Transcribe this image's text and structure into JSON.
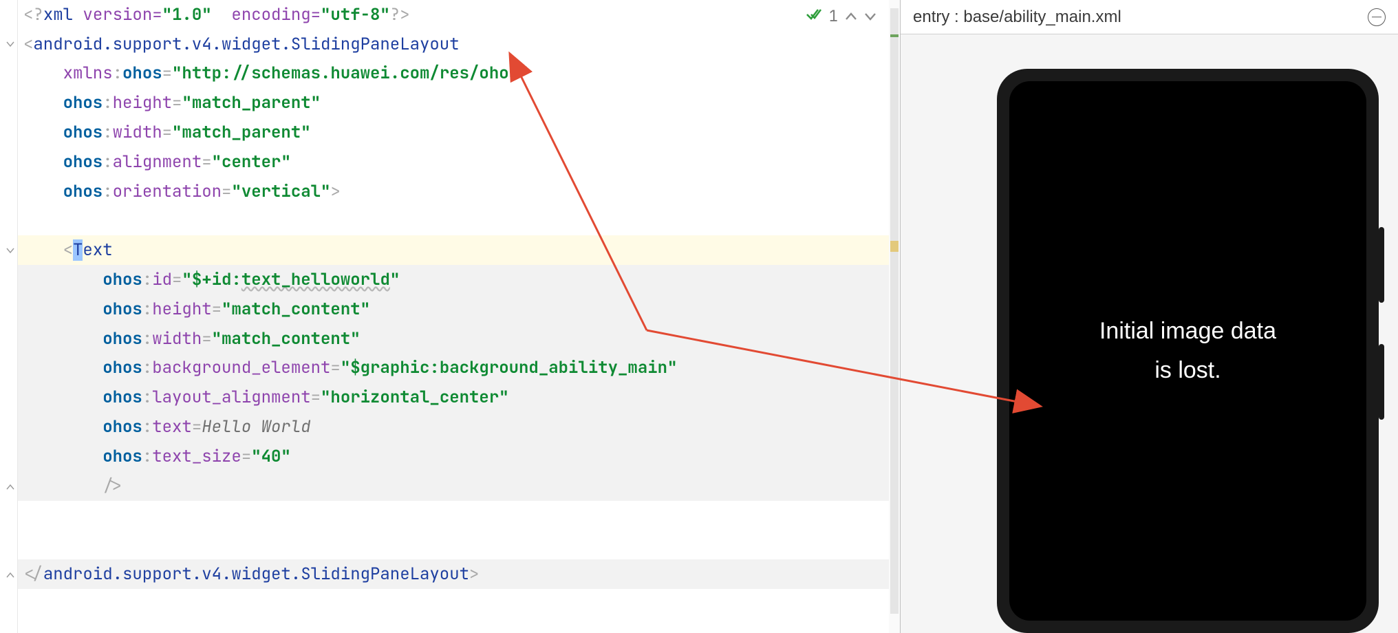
{
  "editor": {
    "inspections": {
      "okCount": "1"
    },
    "tokens": {
      "xml_open": "<?",
      "xml": "xml",
      "version_k": " version=",
      "version_v": "\"1.0\"",
      "encoding_k": "  encoding=",
      "encoding_v": "\"utf-8\"",
      "xml_close": "?>",
      "lt": "<",
      "gt": ">",
      "slash": "/",
      "eq": "=",
      "end_gt": ">",
      "root": "android.support.v4.widget.SlidingPaneLayout",
      "xmlns": "xmlns",
      "ohos": "ohos",
      "schema": "\"http://schemas.huawei.com/res/ohos\"",
      "height": "height",
      "width": "width",
      "alignment": "alignment",
      "orientation": "orientation",
      "id": "id",
      "bg": "background_element",
      "la": "layout_alignment",
      "text": "text",
      "tsize": "text_size",
      "match_parent": "\"match_parent\"",
      "center": "\"center\"",
      "vertical": "\"vertical\"",
      "Text": "Text",
      "idv": "\"$+id:",
      "idname": "text_helloworld",
      "idq": "\"",
      "match_content": "\"match_content\"",
      "bgv": "\"$graphic:background_ability_main\"",
      "lav": "\"horizontal_center\"",
      "hello": "Hello World",
      "forty": "\"40\""
    }
  },
  "preview": {
    "headerLabel": "entry : base/ability_main.xml",
    "screen": {
      "line1": "Initial image data",
      "line2": "is lost."
    }
  },
  "colors": {
    "arrow": "#e24a33"
  }
}
